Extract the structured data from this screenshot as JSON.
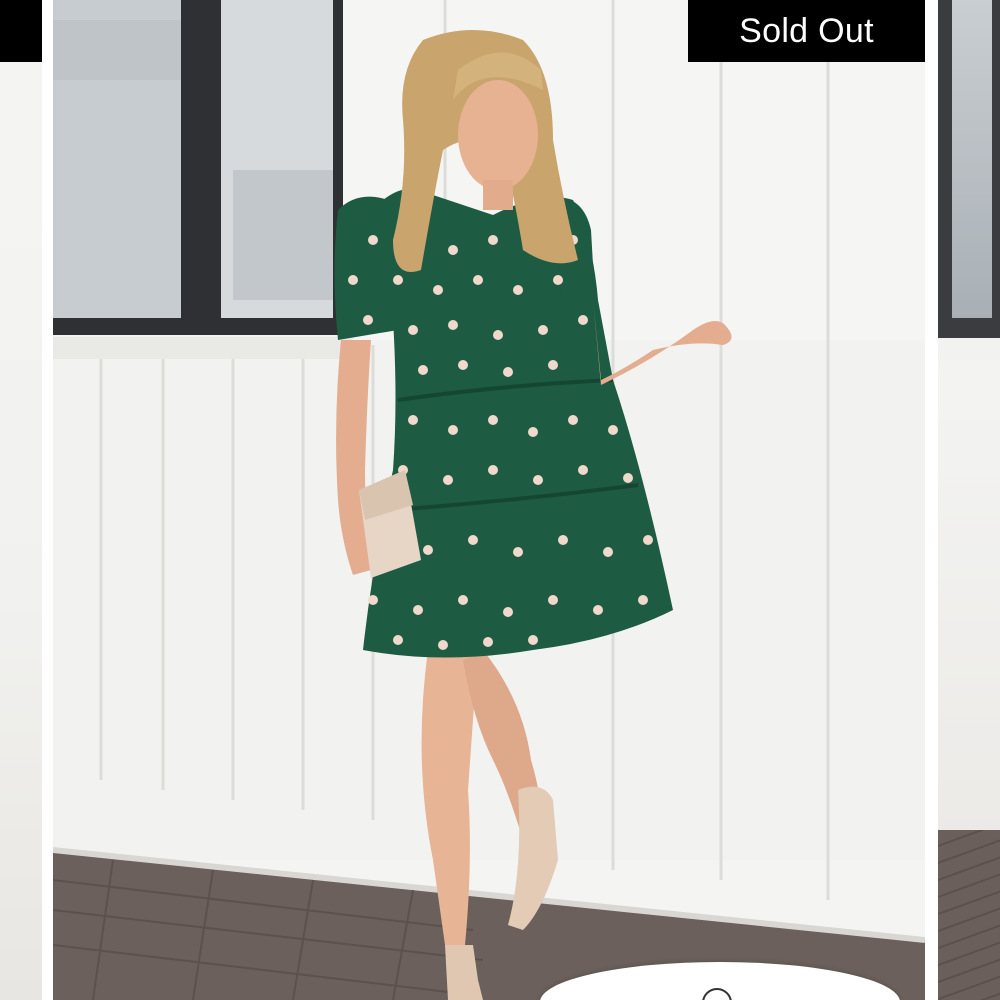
{
  "product_gallery": {
    "badge_text": "Sold Out",
    "neighbor_left_badge_text": "",
    "zoom_icon": "magnifier-icon",
    "image_subject": "product-photo"
  },
  "colors": {
    "badge_background": "#000000",
    "badge_text": "#ffffff",
    "dress_green": "#1d5b43",
    "wall_white": "#f4f4f2"
  }
}
